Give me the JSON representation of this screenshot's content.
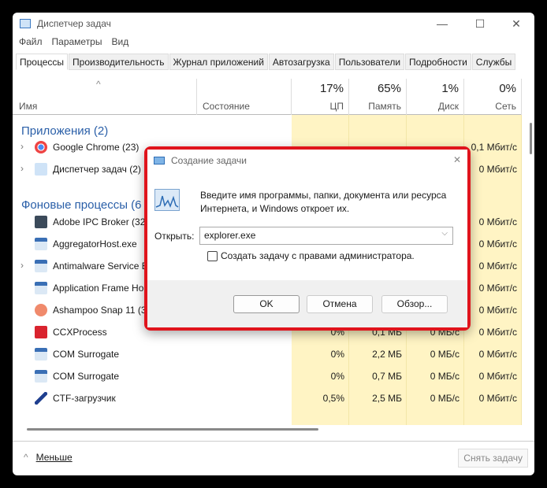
{
  "window": {
    "title": "Диспетчер задач",
    "minimize": "—",
    "maximize": "☐",
    "close": "✕"
  },
  "menu": [
    "Файл",
    "Параметры",
    "Вид"
  ],
  "tabs": [
    "Процессы",
    "Производительность",
    "Журнал приложений",
    "Автозагрузка",
    "Пользователи",
    "Подробности",
    "Службы"
  ],
  "header": {
    "sort_icon": "^",
    "name": "Имя",
    "status": "Состояние",
    "cpu_pct": "17%",
    "cpu": "ЦП",
    "mem_pct": "65%",
    "mem": "Память",
    "disk_pct": "1%",
    "disk": "Диск",
    "net_pct": "0%",
    "net": "Сеть"
  },
  "groups": {
    "apps": "Приложения (2)",
    "background": "Фоновые процессы (6"
  },
  "rows": [
    {
      "name": "Google Chrome (23)",
      "net": "0,1 Мбит/с",
      "expand": true,
      "icon": "chrome-icon"
    },
    {
      "name": "Диспетчер задач (2)",
      "net": "0 Мбит/с",
      "expand": true,
      "icon": "task-manager-icon"
    },
    {
      "name": "Adobe IPC Broker (32",
      "net": "0 Мбит/с",
      "icon": "adobe-ipc-icon"
    },
    {
      "name": "AggregatorHost.exe",
      "net": "0 Мбит/с",
      "icon": "app-window-icon"
    },
    {
      "name": "Antimalware Service E",
      "net": "0 Мбит/с",
      "expand": true,
      "icon": "app-window-icon"
    },
    {
      "name": "Application Frame Ho",
      "net": "0 Мбит/с",
      "icon": "app-window-icon"
    },
    {
      "name": "Ashampoo Snap 11 (3",
      "net": "0 Мбит/с",
      "icon": "ashampoo-icon"
    },
    {
      "name": "CCXProcess",
      "cpu": "0%",
      "mem": "0,1 МБ",
      "disk": "0 МБ/с",
      "net": "0 Мбит/с",
      "icon": "adobe-cc-icon"
    },
    {
      "name": "COM Surrogate",
      "cpu": "0%",
      "mem": "2,2 МБ",
      "disk": "0 МБ/с",
      "net": "0 Мбит/с",
      "icon": "app-window-icon"
    },
    {
      "name": "COM Surrogate",
      "cpu": "0%",
      "mem": "0,7 МБ",
      "disk": "0 МБ/с",
      "net": "0 Мбит/с",
      "icon": "app-window-icon"
    },
    {
      "name": "CTF-загрузчик",
      "cpu": "0,5%",
      "mem": "2,5 МБ",
      "disk": "0 МБ/с",
      "net": "0 Мбит/с",
      "icon": "ctf-pen-icon"
    }
  ],
  "footer": {
    "less": "Меньше",
    "end_task": "Снять задачу"
  },
  "dialog": {
    "title": "Создание задачи",
    "message": "Введите имя программы, папки, документа или ресурса Интернета, и Windows откроет их.",
    "open_label": "Открыть:",
    "open_value": "explorer.exe",
    "admin_checkbox": "Создать задачу с правами администратора.",
    "admin_checked": false,
    "ok": "OK",
    "cancel": "Отмена",
    "browse": "Обзор...",
    "close": "✕"
  },
  "colors": {
    "highlight": "#e0141c",
    "group": "#2a5fa8",
    "heat": "#fff4c4"
  }
}
